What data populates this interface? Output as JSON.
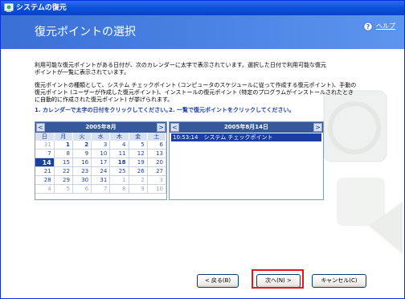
{
  "window": {
    "title": "システムの復元"
  },
  "header": {
    "title": "復元ポイントの選択",
    "help_label": "ヘルプ"
  },
  "intro": {
    "line1": "利用可能な復元ポイントがある日付が、次のカレンダーに太字で表示されています。選択した日付で利用可能な復元",
    "line2": "ポイントが一覧に表示されています。",
    "line3": "復元ポイントの種類として、システム チェックポイント (コンピュータのスケジュールに従って作成する復元ポイント)、手動の",
    "line4": "復元ポイント (ユーザーが作成した復元ポイント)、インストールの復元ポイント (特定のプログラムがインストールされたとき",
    "line5": "に自動的に作成された復元ポイント) が挙げられます。"
  },
  "instructions": {
    "step1": "1. カレンダーで太字の日付をクリックしてください。",
    "step2": "2. 一覧で復元ポイントをクリックしてください。"
  },
  "calendar": {
    "month_title": "2005年8月",
    "prev": "<",
    "next": ">",
    "weekdays": [
      "日",
      "月",
      "火",
      "水",
      "木",
      "金",
      "土"
    ],
    "weeks": [
      [
        "31",
        "1",
        "2",
        "3",
        "4",
        "5",
        "6"
      ],
      [
        "7",
        "8",
        "9",
        "10",
        "11",
        "12",
        "13"
      ],
      [
        "14",
        "15",
        "16",
        "17",
        "18",
        "19",
        "20"
      ],
      [
        "21",
        "22",
        "23",
        "24",
        "25",
        "26",
        "27"
      ],
      [
        "28",
        "29",
        "30",
        "31",
        "1",
        "2",
        "3"
      ],
      [
        "4",
        "5",
        "6",
        "7",
        "8",
        "9",
        "10"
      ]
    ],
    "selected": "14"
  },
  "restore_list": {
    "date_title": "2005年8月14日",
    "prev": "<",
    "next": ">",
    "items": [
      "10:53:14　システム チェックポイント"
    ]
  },
  "buttons": {
    "back": "< 戻る(B)",
    "next": "次へ(N) >",
    "cancel": "キャンセル(C)"
  },
  "colors": {
    "accent": "#1c3ea3",
    "header": "#4d86e6",
    "highlight": "#e8141a"
  }
}
